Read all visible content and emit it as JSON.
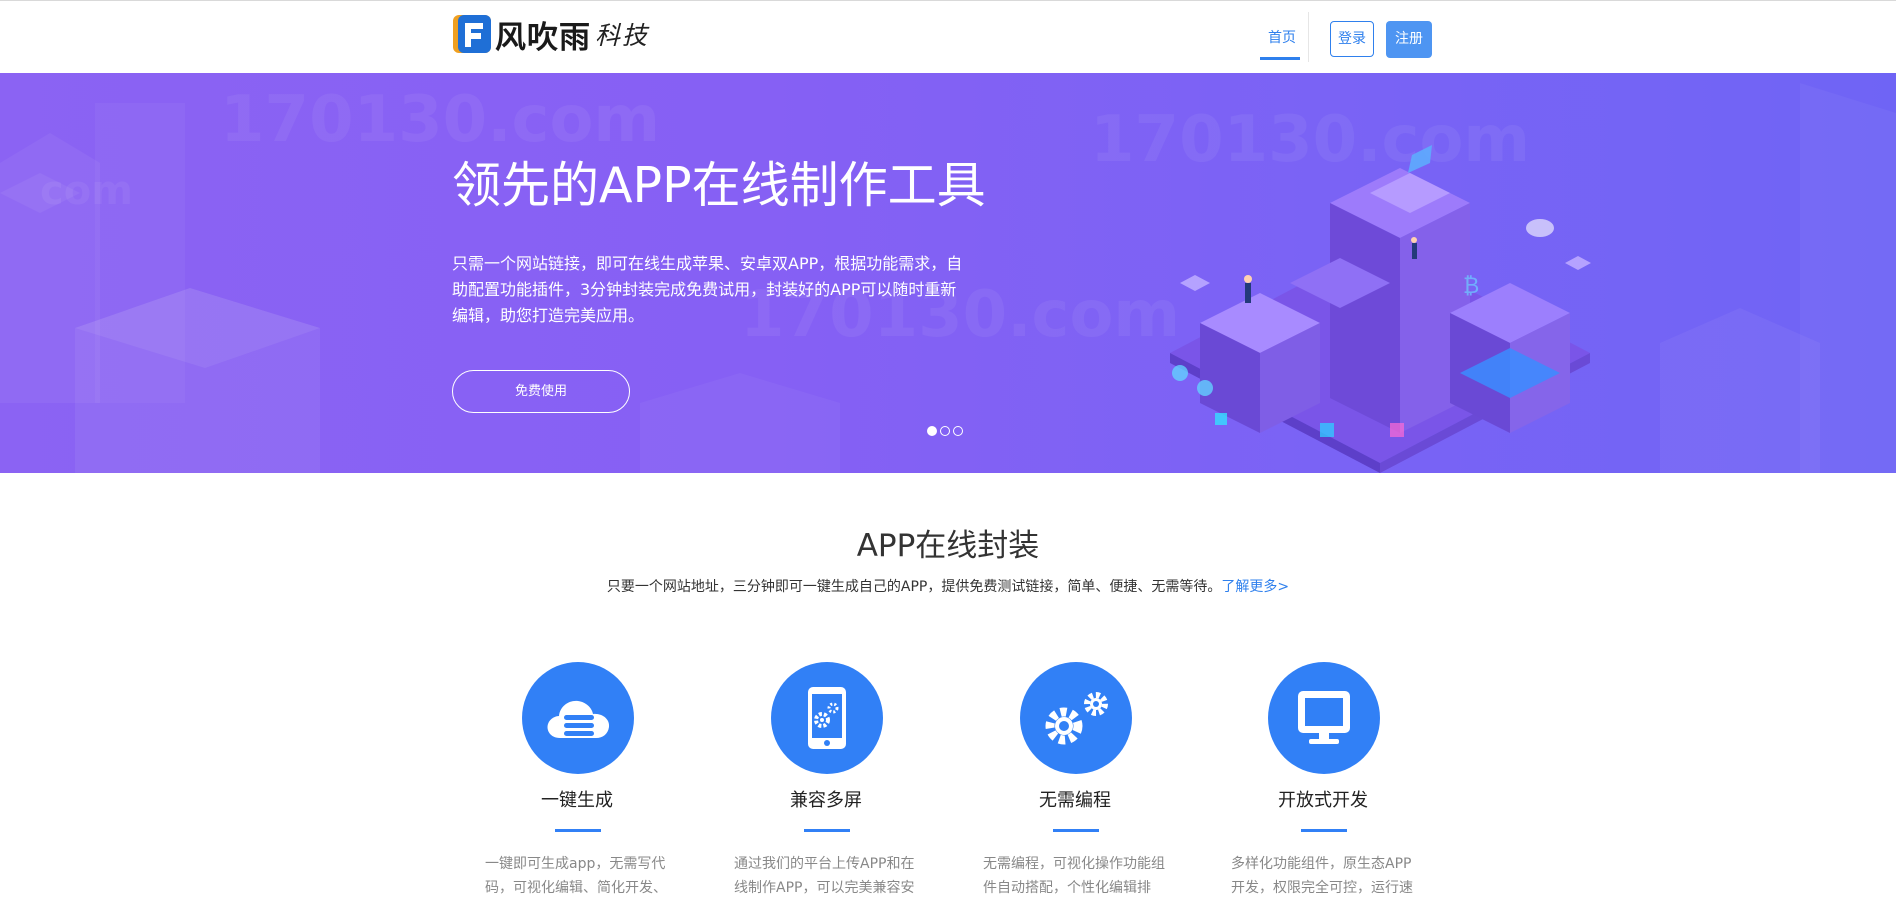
{
  "header": {
    "logo_text": "风吹雨",
    "logo_sub": "科技",
    "nav": {
      "home_label": "首页"
    },
    "login_label": "登录",
    "register_label": "注册"
  },
  "hero": {
    "title": "领先的APP在线制作工具",
    "description": "只需一个网站链接，即可在线生成苹果、安卓双APP，根据功能需求，自助配置功能插件，3分钟封装完成免费试用，封装好的APP可以随时重新编辑，助您打造完美应用。",
    "cta_label": "免费使用",
    "watermarks": [
      "170130.com",
      "170130.com",
      "170130.com",
      "com"
    ],
    "slide_count": 3,
    "active_slide": 1
  },
  "section": {
    "title": "APP在线封装",
    "subtitle": "只要一个网站地址，三分钟即可一键生成自己的APP，提供免费测试链接，简单、便捷、无需等待。",
    "learn_more": "了解更多>"
  },
  "features": [
    {
      "icon": "cloud-database-icon",
      "title": "一键生成",
      "desc": "一键即可生成app，无需写代码，可视化编辑、简化开发、"
    },
    {
      "icon": "mobile-gear-icon",
      "title": "兼容多屏",
      "desc": "通过我们的平台上传APP和在线制作APP，可以完美兼容安"
    },
    {
      "icon": "gears-icon",
      "title": "无需编程",
      "desc": "无需编程，可视化操作功能组件自动搭配，个性化编辑排"
    },
    {
      "icon": "monitor-icon",
      "title": "开放式开发",
      "desc": "多样化功能组件，原生态APP开发，权限完全可控，运行速"
    }
  ],
  "colors": {
    "accent": "#3180f6",
    "hero_start": "#8b63f3",
    "hero_end": "#6f64f5"
  }
}
